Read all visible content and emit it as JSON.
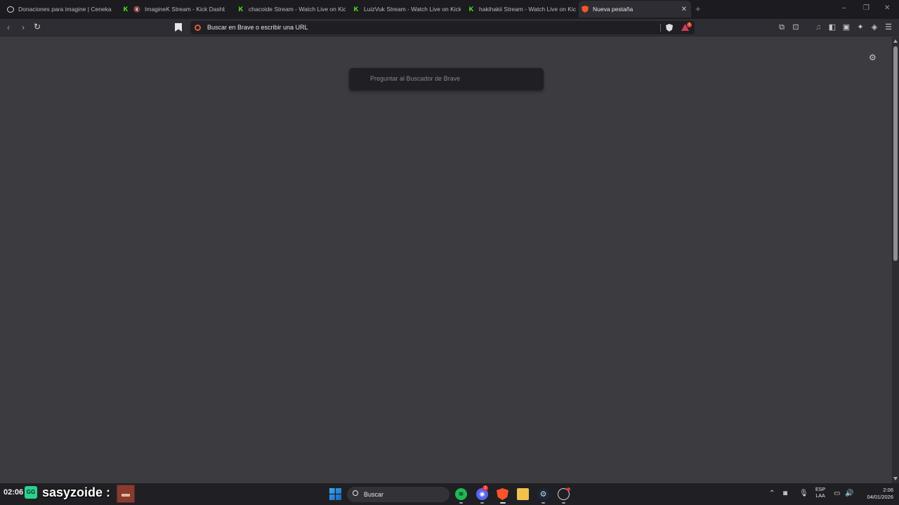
{
  "tabs": [
    {
      "title": "Donaciones para imagine | Ceneka",
      "favicon": "ceneka-icon"
    },
    {
      "title": "ImagineK Stream - Kick Dashboard",
      "favicon": "kick-icon",
      "muted": true
    },
    {
      "title": "chacoide Stream - Watch Live on Kick",
      "favicon": "kick-icon"
    },
    {
      "title": "LuizVuk Stream - Watch Live on Kick",
      "favicon": "kick-icon"
    },
    {
      "title": "hakihakii Stream - Watch Live on Kick",
      "favicon": "kick-icon"
    },
    {
      "title": "Nueva pestaña",
      "favicon": "brave-icon",
      "active": true
    }
  ],
  "toolbar": {
    "address_placeholder": "Buscar en Brave o escribir una URL",
    "rewards_badge": "1"
  },
  "newtab": {
    "search_placeholder": "Preguntar al Buscador de Brave"
  },
  "stream_overlay": {
    "time": "02:06",
    "emote": "GG",
    "username": "sasyzoide :"
  },
  "taskbar": {
    "search_label": "Buscar",
    "discord_badge": "2",
    "language_line1": "ESP",
    "language_line2": "LAA",
    "clock_time": "2:06",
    "clock_date": "04/01/2026"
  },
  "colors": {
    "page_bg": "#3b3b40",
    "tabbar_bg": "#1c1c20",
    "kick_green": "#53fc18",
    "brave_orange": "#fb542b"
  }
}
